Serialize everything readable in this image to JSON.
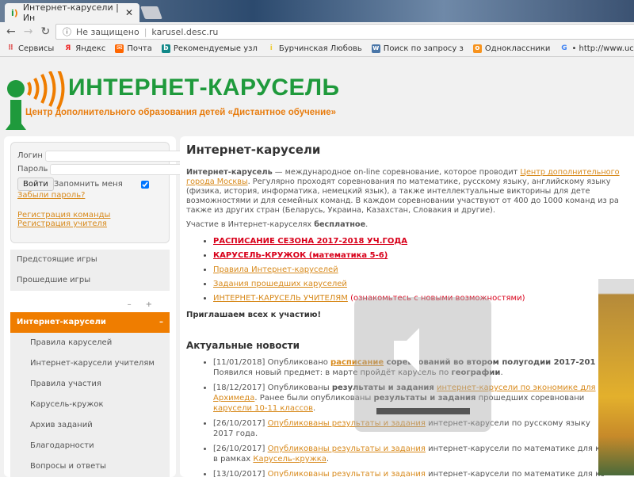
{
  "browser": {
    "tab_title": "Интернет-карусели | Ин",
    "security": "Не защищено",
    "url": "karusel.desc.ru",
    "bookmarks": [
      "Сервисы",
      "Яндекс",
      "Почта",
      "Рекомендуемые узл",
      "Бурчинская Любовь",
      "Поиск по запросу з",
      "Одноклассники",
      "• http://www.uchport"
    ]
  },
  "logo": {
    "title": "ИНТЕРНЕТ-КАРУСЕЛЬ",
    "subtitle": "Центр дополнительного образования детей «Дистантное обучение»"
  },
  "login": {
    "login_label": "Логин",
    "password_label": "Пароль",
    "submit": "Войти",
    "remember": "Запомнить меня",
    "forgot": "Забыли пароль?",
    "reg_team": "Регистрация команды",
    "reg_teacher": "Регистрация учителя"
  },
  "menu": {
    "items": [
      "Предстоящие игры",
      "Прошедшие игры"
    ],
    "collapse": "–",
    "expand": "+",
    "active": "Интернет-карусели",
    "active_toggle": "–",
    "sub": [
      "Правила каруселей",
      "Интернет-карусели учителям",
      "Правила участия",
      "Карусель-кружок",
      "Архив заданий",
      "Благодарности",
      "Вопросы и ответы"
    ]
  },
  "main": {
    "title": "Интернет-карусели",
    "intro_bold": "Интернет-карусель",
    "intro_1": " — международное on-line соревнование, которое проводит ",
    "intro_link": "Центр дополнительного",
    "intro_link2": "города Москвы",
    "intro_2": ". Регулярно проходят соревнования по математике, русскому языку, английскому языку",
    "intro_3": "(физика, история, информатика, немецкий язык), а также интеллектуальные викторины для дете",
    "intro_4": "возможностями и для семейных команд. В каждом соревновании участвуют от 400 до 1000 команд из ра",
    "intro_5": "также из других стран (Беларусь, Украина, Казахстан, Словакия и другие).",
    "free_1": "Участие в Интернет-каруселях ",
    "free_bold": "бесплатное",
    "free_end": ".",
    "links": [
      "РАСПИСАНИЕ СЕЗОНА 2017-2018 УЧ.ГОДА",
      "КАРУСЕЛЬ-КРУЖОК (математика 5-6)",
      "Правила Интернет-каруселей",
      "Задания прошедших каруселей",
      "ИНТЕРНЕТ-КАРУСЕЛЬ УЧИТЕЛЯМ"
    ],
    "links_note": " (ознакомьтесь с новыми возможностями)",
    "invite": "Приглашаем всех к участию!",
    "news_title": "Актуальные новости",
    "news": [
      {
        "date": "[11/01/2018] ",
        "t1": "Опубликовано ",
        "link": "расписание",
        "t2": " соревнований во втором полугодии 2017-201",
        "l2": "Появился новый предмет: в марте пройдёт карусель по ",
        "b2": "географии",
        "e2": "."
      },
      {
        "date": "[18/12/2017] ",
        "t1": "Опубликованы ",
        "b1": "результаты и задания",
        "link": "интернет-карусели по экономике для",
        "l2link": "Архимеда",
        "l2": ". Ранее были опубликованы ",
        "b2": "результаты и задания",
        "l2b": " прошедших соревновани",
        "l3link": "карусели 10-11 классов",
        "l3": "."
      },
      {
        "date": "[26/10/2017] ",
        "link": "Опубликованы результаты и задания",
        "t2": " интернет-карусели по русскому языку",
        "l2": "2017 года."
      },
      {
        "date": "[26/10/2017] ",
        "link": "Опубликованы результаты и задания",
        "t2": " интернет-карусели по математике для к",
        "l2": "в рамках ",
        "l2link": "Карусель-кружка",
        "e2": "."
      },
      {
        "date": "[13/10/2017] ",
        "link": "Опубликованы результаты и задания",
        "t2": " интернет-карусели по математике для кс"
      }
    ]
  },
  "colors": {
    "green": "#1f9a3c",
    "orange": "#ef7d00",
    "link": "#d88a1c",
    "red": "#d8001a"
  }
}
